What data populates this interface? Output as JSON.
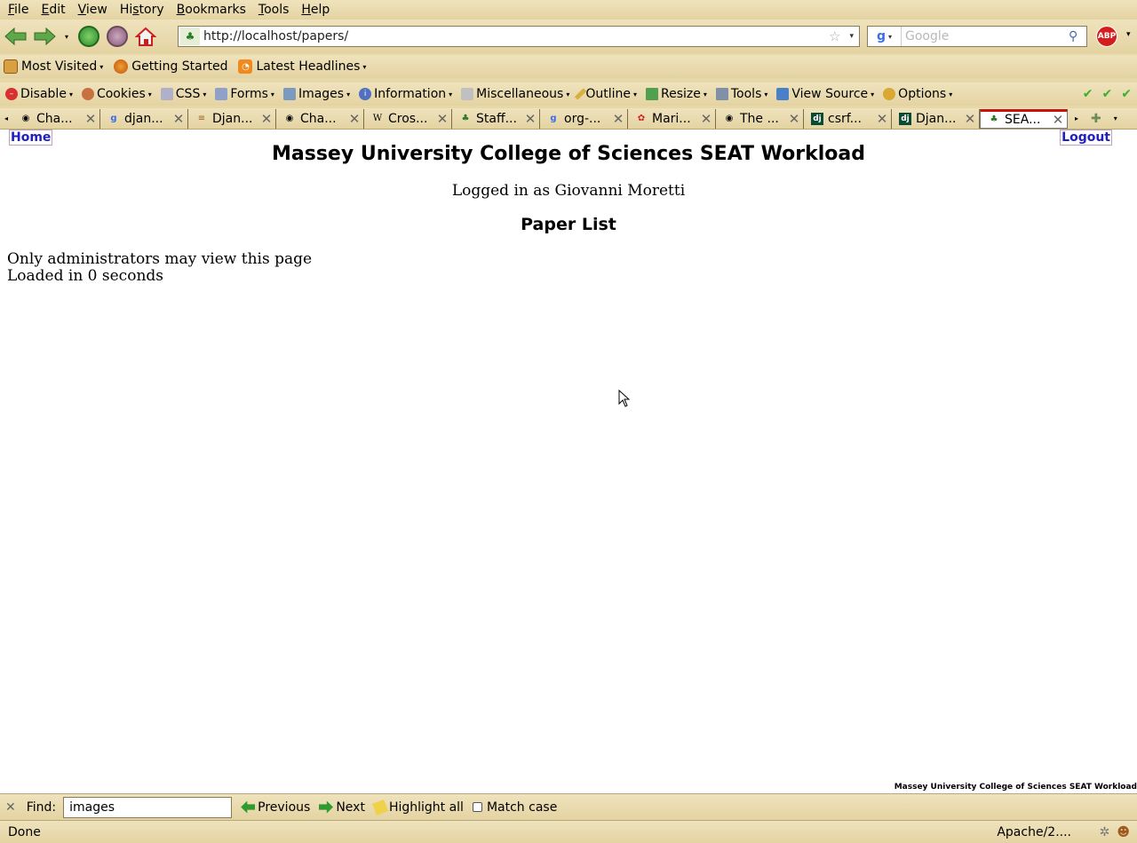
{
  "menubar": {
    "items": [
      {
        "pre": "",
        "key": "F",
        "post": "ile"
      },
      {
        "pre": "",
        "key": "E",
        "post": "dit"
      },
      {
        "pre": "",
        "key": "V",
        "post": "iew"
      },
      {
        "pre": "Hi",
        "key": "s",
        "post": "tory"
      },
      {
        "pre": "",
        "key": "B",
        "post": "ookmarks"
      },
      {
        "pre": "",
        "key": "T",
        "post": "ools"
      },
      {
        "pre": "",
        "key": "H",
        "post": "elp"
      }
    ]
  },
  "navbar": {
    "url": "http://localhost/papers/",
    "search_placeholder": "Google",
    "abp_label": "ABP"
  },
  "bookmarks": [
    {
      "label": "Most Visited",
      "icon": "most-visited-icon",
      "dropdown": true
    },
    {
      "label": "Getting Started",
      "icon": "firefox-icon",
      "dropdown": false
    },
    {
      "label": "Latest Headlines",
      "icon": "rss-icon",
      "dropdown": true
    }
  ],
  "devbar": [
    {
      "label": "Disable",
      "icon": "disable-icon"
    },
    {
      "label": "Cookies",
      "icon": "cookies-icon"
    },
    {
      "label": "CSS",
      "icon": "css-icon"
    },
    {
      "label": "Forms",
      "icon": "forms-icon"
    },
    {
      "label": "Images",
      "icon": "images-icon"
    },
    {
      "label": "Information",
      "icon": "information-icon"
    },
    {
      "label": "Miscellaneous",
      "icon": "miscellaneous-icon"
    },
    {
      "label": "Outline",
      "icon": "outline-icon"
    },
    {
      "label": "Resize",
      "icon": "resize-icon"
    },
    {
      "label": "Tools",
      "icon": "tools-icon"
    },
    {
      "label": "View Source",
      "icon": "view-source-icon"
    },
    {
      "label": "Options",
      "icon": "options-icon"
    }
  ],
  "tabs": [
    {
      "title": "Cha...",
      "icon": "page-icon"
    },
    {
      "title": "djan...",
      "icon": "google-icon"
    },
    {
      "title": "Djan...",
      "icon": "stack-icon"
    },
    {
      "title": "Cha...",
      "icon": "page-icon"
    },
    {
      "title": "Cros...",
      "icon": "wikipedia-icon"
    },
    {
      "title": "Staff...",
      "icon": "fern-icon"
    },
    {
      "title": "org-...",
      "icon": "google-icon"
    },
    {
      "title": "Mari...",
      "icon": "flower-icon"
    },
    {
      "title": "The ...",
      "icon": "page-icon"
    },
    {
      "title": "csrf...",
      "icon": "django-icon"
    },
    {
      "title": "Djan...",
      "icon": "django-icon"
    },
    {
      "title": "SEA...",
      "icon": "fern-icon",
      "active": true
    }
  ],
  "page": {
    "home_link": "Home",
    "logout_link": "Logout",
    "site_title": "Massey University College of Sciences SEAT Workload",
    "logged_in": "Logged in as Giovanni Moretti",
    "heading": "Paper List",
    "message": "Only administrators may view this page",
    "loaded": "Loaded in 0 seconds",
    "footer": "Massey University College of Sciences SEAT Workload"
  },
  "findbar": {
    "label": "Find:",
    "value": "images",
    "previous": "Previous",
    "next": "Next",
    "highlight": "Highlight all",
    "match_case": "Match case"
  },
  "status": {
    "text": "Done",
    "server": "Apache/2...."
  }
}
